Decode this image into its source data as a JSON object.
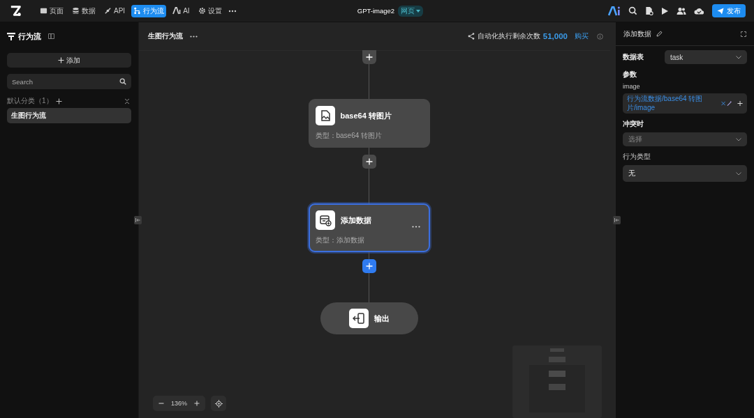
{
  "topbar": {
    "nav": [
      {
        "label": "页面",
        "selected": false
      },
      {
        "label": "数据",
        "selected": false
      },
      {
        "label": "API",
        "selected": false
      },
      {
        "label": "行为流",
        "selected": true
      },
      {
        "label": "AI",
        "selected": false
      },
      {
        "label": "设置",
        "selected": false
      }
    ],
    "title": "GPT-image2",
    "tag": "网页",
    "publish": "发布"
  },
  "sidebar": {
    "title": "行为流",
    "add": "添加",
    "search": {
      "placeholder": "Search"
    },
    "group": "默认分类（1）",
    "items": [
      {
        "label": "生图行为流",
        "selected": true
      }
    ]
  },
  "canvas": {
    "title": "生图行为流",
    "quota_label": "自动化执行剩余次数",
    "quota": "51,000",
    "buy": "购买",
    "flow": [
      {
        "kind": "add",
        "selected": false
      },
      {
        "kind": "convert",
        "title": "base64 转图片",
        "subtitle": "类型：base64 转图片",
        "selected": false
      },
      {
        "kind": "add",
        "selected": false
      },
      {
        "kind": "insert",
        "title": "添加数据",
        "subtitle": "类型：添加数据",
        "selected": true
      },
      {
        "kind": "add",
        "selected": true
      },
      {
        "kind": "end",
        "title": "输出"
      }
    ],
    "zoom": "136%"
  },
  "panel": {
    "title": "添加数据",
    "table_label": "数据表",
    "table_value": "task",
    "params_label": "参数",
    "param_name": "image",
    "param_value": "行为流数据/base64 转图片/image",
    "fields": [
      {
        "label": "冲突时",
        "placeholder": "选择"
      },
      {
        "label": "行为类型",
        "value": "无"
      }
    ]
  }
}
